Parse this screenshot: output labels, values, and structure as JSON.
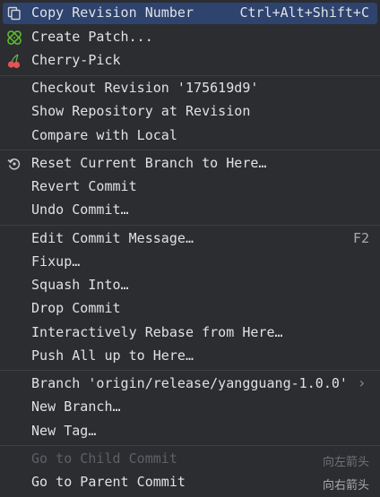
{
  "menu": {
    "copy_revision": {
      "label": "Copy Revision Number",
      "shortcut": "Ctrl+Alt+Shift+C",
      "icon": "copy-icon"
    },
    "create_patch": {
      "label": "Create Patch...",
      "icon": "patch-icon"
    },
    "cherry_pick": {
      "label": "Cherry-Pick",
      "icon": "cherry-icon"
    },
    "checkout_revision": {
      "label": "Checkout Revision '175619d9'"
    },
    "show_repository": {
      "label": "Show Repository at Revision"
    },
    "compare_local": {
      "label": "Compare with Local"
    },
    "reset_branch": {
      "label": "Reset Current Branch to Here…",
      "icon": "reset-icon"
    },
    "revert_commit": {
      "label": "Revert Commit"
    },
    "undo_commit": {
      "label": "Undo Commit…"
    },
    "edit_message": {
      "label": "Edit Commit Message…",
      "shortcut": "F2"
    },
    "fixup": {
      "label": "Fixup…"
    },
    "squash_into": {
      "label": "Squash Into…"
    },
    "drop_commit": {
      "label": "Drop Commit"
    },
    "interactive_rebase": {
      "label": "Interactively Rebase from Here…"
    },
    "push_all": {
      "label": "Push All up to Here…"
    },
    "branch_submenu": {
      "label": "Branch 'origin/release/yangguang-1.0.0'",
      "arrow": "›"
    },
    "new_branch": {
      "label": "New Branch…"
    },
    "new_tag": {
      "label": "New Tag…"
    },
    "go_child": {
      "label": "Go to Child Commit",
      "shortcut": "向左箭头"
    },
    "go_parent": {
      "label": "Go to Parent Commit",
      "shortcut": "向右箭头"
    }
  },
  "colors": {
    "background": "#2b2d30",
    "selection": "#2e436e",
    "separator": "#3c3f44",
    "text": "#dfe1e5",
    "disabled_text": "#5e6066",
    "patch_icon": "#5fb832",
    "cherry_icon": "#e55353"
  }
}
